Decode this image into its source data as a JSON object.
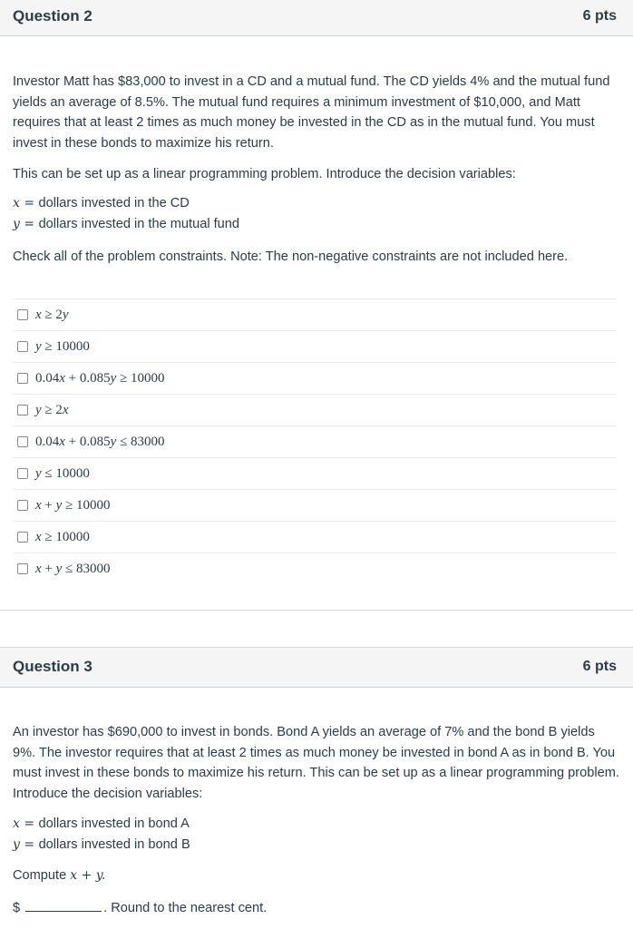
{
  "questions": [
    {
      "title": "Question 2",
      "points": "6 pts",
      "body": "Investor Matt has $83,000 to invest in a CD and a mutual fund.  The CD yields 4% and the mutual fund yields an average of 8.5%.  The mutual fund requires a minimum investment of $10,000, and Matt requires that at least 2 times as much money be invested in the CD as in the mutual fund.  You must invest in these bonds to maximize his return.",
      "setup": "This can be set up as a linear programming problem.  Introduce the decision variables:",
      "variables": [
        {
          "symbol": "x",
          "eq": " = ",
          "desc": "dollars invested in the CD"
        },
        {
          "symbol": "y",
          "eq": " = ",
          "desc": "dollars invested in the mutual fund"
        }
      ],
      "instruction": "Check all of the problem constraints.  Note: The non-negative constraints are not included here.",
      "options": [
        {
          "text": "x ≥ 2y",
          "checked": false
        },
        {
          "text": "y ≥ 10000",
          "checked": false
        },
        {
          "text": "0.04x + 0.085y ≥ 10000",
          "checked": false
        },
        {
          "text": "y ≥ 2x",
          "checked": false
        },
        {
          "text": "0.04x + 0.085y ≤ 83000",
          "checked": false
        },
        {
          "text": "y ≤ 10000",
          "checked": false
        },
        {
          "text": "x + y ≥ 10000",
          "checked": false
        },
        {
          "text": "x ≥ 10000",
          "checked": false
        },
        {
          "text": "x + y ≤ 83000",
          "checked": false
        }
      ]
    },
    {
      "title": "Question 3",
      "points": "6 pts",
      "body": "An investor has $690,000 to invest in bonds.  Bond A yields an average of 7% and the bond B yields 9%.  The investor requires that at least 2 times as much money be invested in bond A as in bond B.  You must invest in these bonds to maximize his return.  This can be set up as a linear programming problem.  Introduce the decision variables:",
      "variables": [
        {
          "symbol": "x",
          "eq": " = ",
          "desc": "dollars invested in bond A"
        },
        {
          "symbol": "y",
          "eq": " = ",
          "desc": "dollars invested in bond B"
        }
      ],
      "compute_label": "Compute ",
      "compute_expr": "x + y.",
      "answer_prefix": "$",
      "answer_value": "",
      "answer_suffix": ".  Round to the nearest cent."
    }
  ]
}
